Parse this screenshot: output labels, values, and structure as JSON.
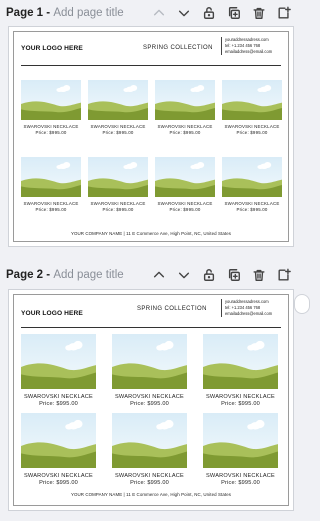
{
  "pages": [
    {
      "label": "Page 1",
      "separator": " - ",
      "add_title": "Add page title",
      "columns": 4,
      "products": [
        {
          "name": "SWAROVSKI NECKLACE",
          "price": "Price: $995.00"
        },
        {
          "name": "SWAROVSKI NECKLACE",
          "price": "Price: $995.00"
        },
        {
          "name": "SWAROVSKI NECKLACE",
          "price": "Price: $995.00"
        },
        {
          "name": "SWAROVSKI NECKLACE",
          "price": "Price: $995.00"
        },
        {
          "name": "SWAROVSKI NECKLACE",
          "price": "Price: $995.00"
        },
        {
          "name": "SWAROVSKI NECKLACE",
          "price": "Price: $995.00"
        },
        {
          "name": "SWAROVSKI NECKLACE",
          "price": "Price: $995.00"
        },
        {
          "name": "SWAROVSKI NECKLACE",
          "price": "Price: $995.00"
        }
      ]
    },
    {
      "label": "Page 2",
      "separator": " - ",
      "add_title": "Add page title",
      "columns": 3,
      "products": [
        {
          "name": "SWAROVSKI NECKLACE",
          "price": "Price: $995.00"
        },
        {
          "name": "SWAROVSKI NECKLACE",
          "price": "Price: $995.00"
        },
        {
          "name": "SWAROVSKI NECKLACE",
          "price": "Price: $995.00"
        },
        {
          "name": "SWAROVSKI NECKLACE",
          "price": "Price: $995.00"
        },
        {
          "name": "SWAROVSKI NECKLACE",
          "price": "Price: $995.00"
        },
        {
          "name": "SWAROVSKI NECKLACE",
          "price": "Price: $995.00"
        }
      ]
    }
  ],
  "catalog": {
    "logo": "YOUR LOGO HERE",
    "collection": "SPRING COLLECTION",
    "contact": [
      "youraddressadress.com",
      "tel: +1.234 456 768",
      "emailaddress@email.com"
    ],
    "footer": "YOUR COMPANY NAME  |  11 E Commerce Ave, High Point, NC, United States"
  },
  "icons": [
    "chevron-up-icon",
    "chevron-down-icon",
    "lock-icon",
    "duplicate-icon",
    "trash-icon",
    "add-page-icon"
  ],
  "colors": {
    "sky": "#d9ecf7",
    "grass_dark": "#7f9a32",
    "grass_light": "#a9c05a",
    "canvas": "#f0f1f5"
  }
}
